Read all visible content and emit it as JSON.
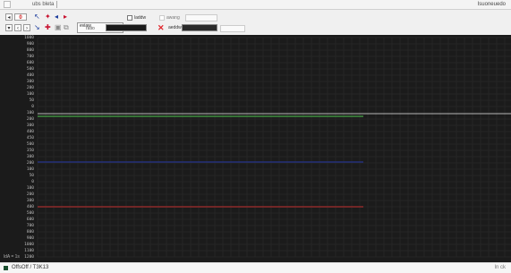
{
  "topbar": {
    "tab1": "",
    "tab2": "ubs bleta",
    "right_label": "Isuoneuedo"
  },
  "toolbar": {
    "counter_value": "0",
    "mode_label": "eviaw",
    "ratio_label": "ratio",
    "ratio_value": "",
    "check1_label": "laddw",
    "check2_label": "awang",
    "field1_label": "",
    "check3_label": "aeddw",
    "field2_label": "",
    "field3_label": ""
  },
  "graph": {
    "y_labels": [
      "1000",
      "900",
      "800",
      "700",
      "600",
      "500",
      "400",
      "300",
      "200",
      "100",
      "50",
      "0",
      "100",
      "200",
      "300",
      "400",
      "450",
      "500",
      "350",
      "300",
      "200",
      "100",
      "50",
      "0",
      "100",
      "200",
      "300",
      "400",
      "500",
      "600",
      "700",
      "800",
      "900",
      "1000",
      "1100",
      "1200"
    ],
    "series_colors": [
      "#3f8f3f",
      "#24307a",
      "#8e2a2a"
    ],
    "footer_label": "ldA = 1s"
  },
  "status": {
    "text": "OffsOff / T3K13",
    "right": "ln  ck"
  }
}
